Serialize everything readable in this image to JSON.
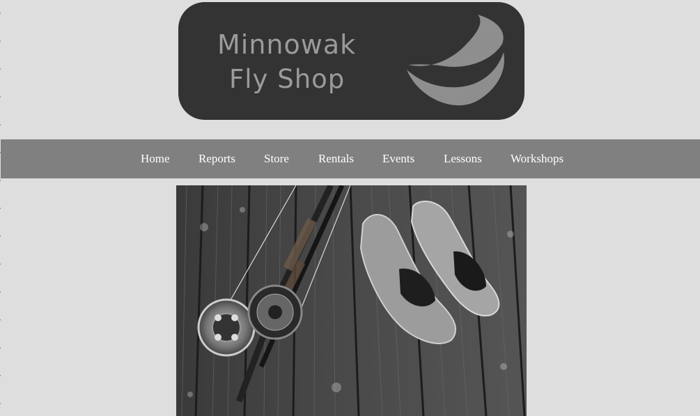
{
  "header": {
    "logo_line1": "Minnowak",
    "logo_line2": "Fly Shop",
    "logo_bg": "#333333",
    "logo_fg": "#9b9b9b"
  },
  "nav": {
    "items": [
      {
        "label": "Home"
      },
      {
        "label": "Reports"
      },
      {
        "label": "Store"
      },
      {
        "label": "Rentals"
      },
      {
        "label": "Events"
      },
      {
        "label": "Lessons"
      },
      {
        "label": "Workshops"
      }
    ],
    "bg": "#808080",
    "fg": "#ffffff"
  },
  "hero": {
    "subject": "fly-rod-reels-and-wading-shoes-on-dock-photo"
  },
  "colors": {
    "page_bg": "#dedede"
  }
}
